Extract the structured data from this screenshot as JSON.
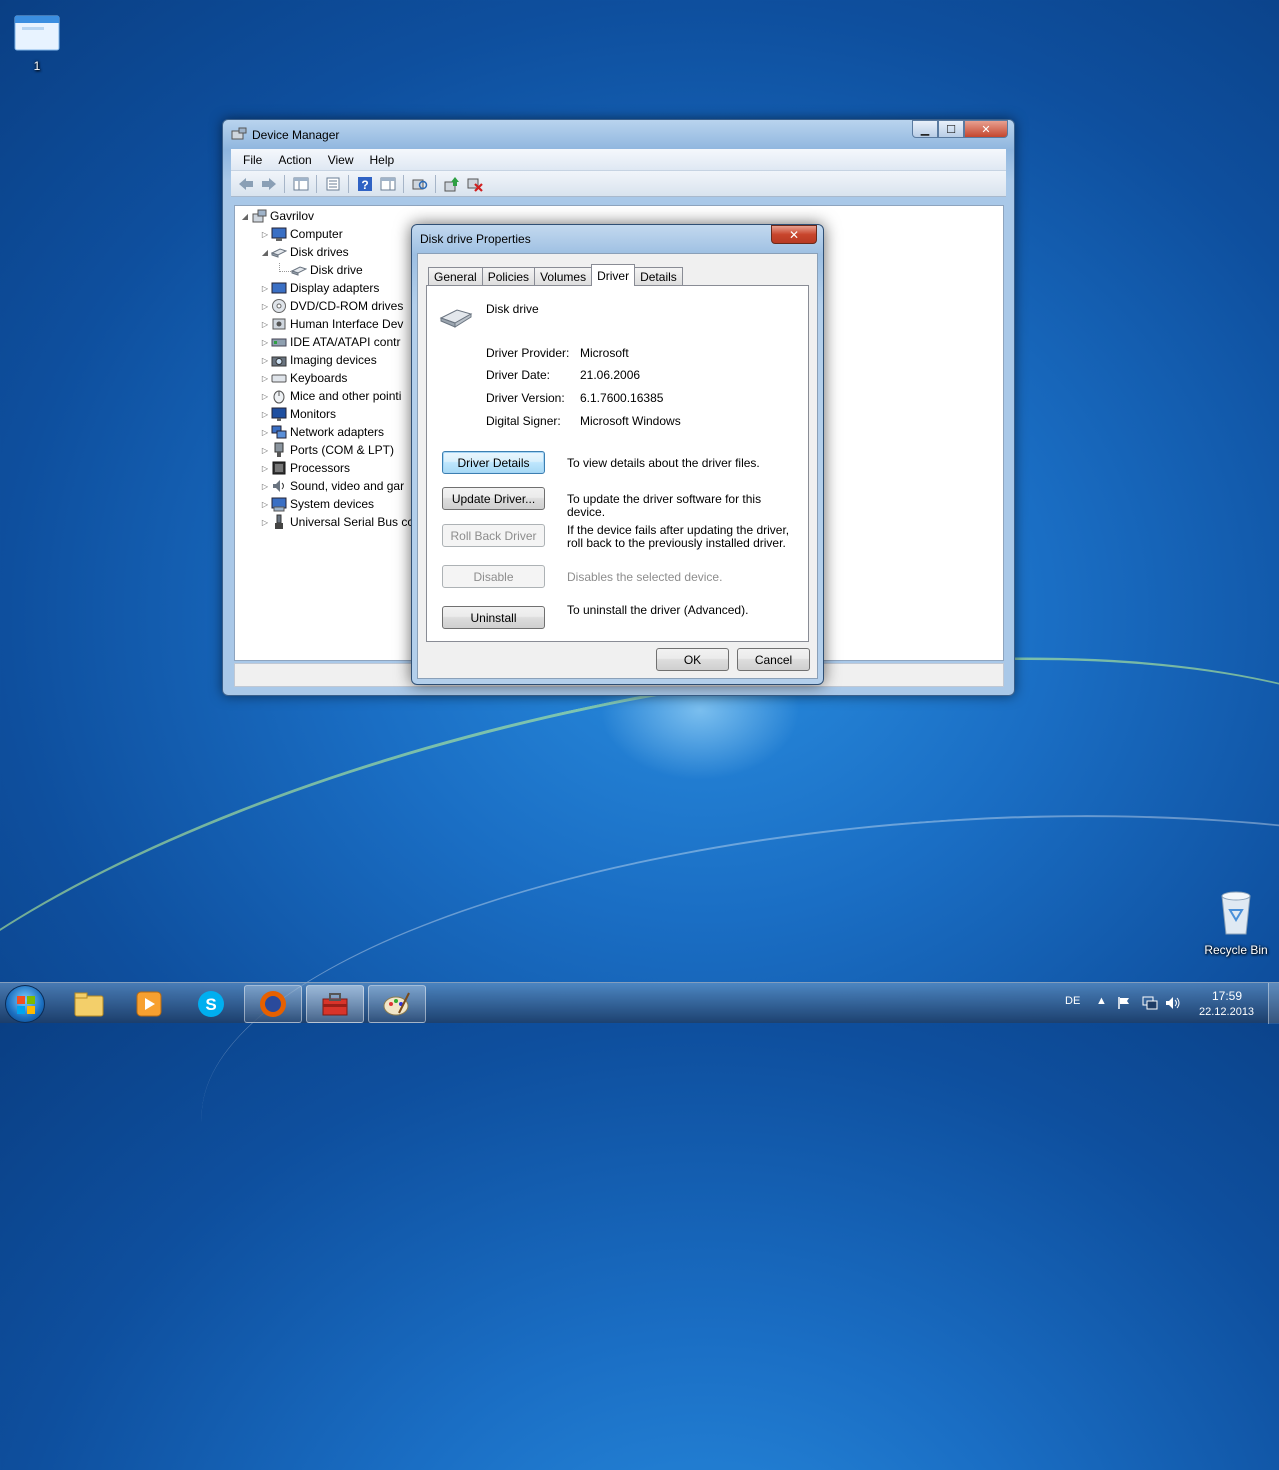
{
  "desktop": {
    "icons": [
      {
        "label": "1"
      },
      {
        "label": "Recycle Bin"
      }
    ]
  },
  "device_manager": {
    "title": "Device Manager",
    "menu": [
      "File",
      "Action",
      "View",
      "Help"
    ],
    "tree": {
      "root": "Gavrilov",
      "items": [
        {
          "label": "Computer",
          "icon": "computer-icon"
        },
        {
          "label": "Disk drives",
          "icon": "disk-drive-icon",
          "expanded": true
        },
        {
          "label": "Disk drive",
          "icon": "disk-drive-icon",
          "child": true
        },
        {
          "label": "Display adapters",
          "icon": "display-adapter-icon"
        },
        {
          "label": "DVD/CD-ROM drives",
          "icon": "dvd-icon"
        },
        {
          "label": "Human Interface Dev",
          "icon": "hid-icon"
        },
        {
          "label": "IDE ATA/ATAPI contr",
          "icon": "ide-icon"
        },
        {
          "label": "Imaging devices",
          "icon": "camera-icon"
        },
        {
          "label": "Keyboards",
          "icon": "keyboard-icon"
        },
        {
          "label": "Mice and other pointi",
          "icon": "mouse-icon"
        },
        {
          "label": "Monitors",
          "icon": "monitor-icon"
        },
        {
          "label": "Network adapters",
          "icon": "network-icon"
        },
        {
          "label": "Ports (COM & LPT)",
          "icon": "port-icon"
        },
        {
          "label": "Processors",
          "icon": "processor-icon"
        },
        {
          "label": "Sound, video and gar",
          "icon": "sound-icon"
        },
        {
          "label": "System devices",
          "icon": "system-icon"
        },
        {
          "label": "Universal Serial Bus cc",
          "icon": "usb-icon"
        }
      ]
    }
  },
  "dialog": {
    "title": "Disk drive Properties",
    "close_label": "✕",
    "tabs": [
      "General",
      "Policies",
      "Volumes",
      "Driver",
      "Details"
    ],
    "active_tab": "Driver",
    "device_name": "Disk drive",
    "info": [
      {
        "label": "Driver Provider:",
        "value": "Microsoft"
      },
      {
        "label": "Driver Date:",
        "value": "21.06.2006"
      },
      {
        "label": "Driver Version:",
        "value": "6.1.7600.16385"
      },
      {
        "label": "Digital Signer:",
        "value": "Microsoft Windows"
      }
    ],
    "actions": [
      {
        "label": "Driver Details",
        "desc": "To view details about the driver files."
      },
      {
        "label": "Update Driver...",
        "desc": "To update the driver software for this device."
      },
      {
        "label": "Roll Back Driver",
        "desc": "If the device fails after updating the driver, roll back to the previously installed driver."
      },
      {
        "label": "Disable",
        "desc": "Disables the selected device."
      },
      {
        "label": "Uninstall",
        "desc": "To uninstall the driver (Advanced)."
      }
    ],
    "ok_label": "OK",
    "cancel_label": "Cancel"
  },
  "taskbar": {
    "language": "DE",
    "time": "17:59",
    "date": "22.12.2013"
  }
}
